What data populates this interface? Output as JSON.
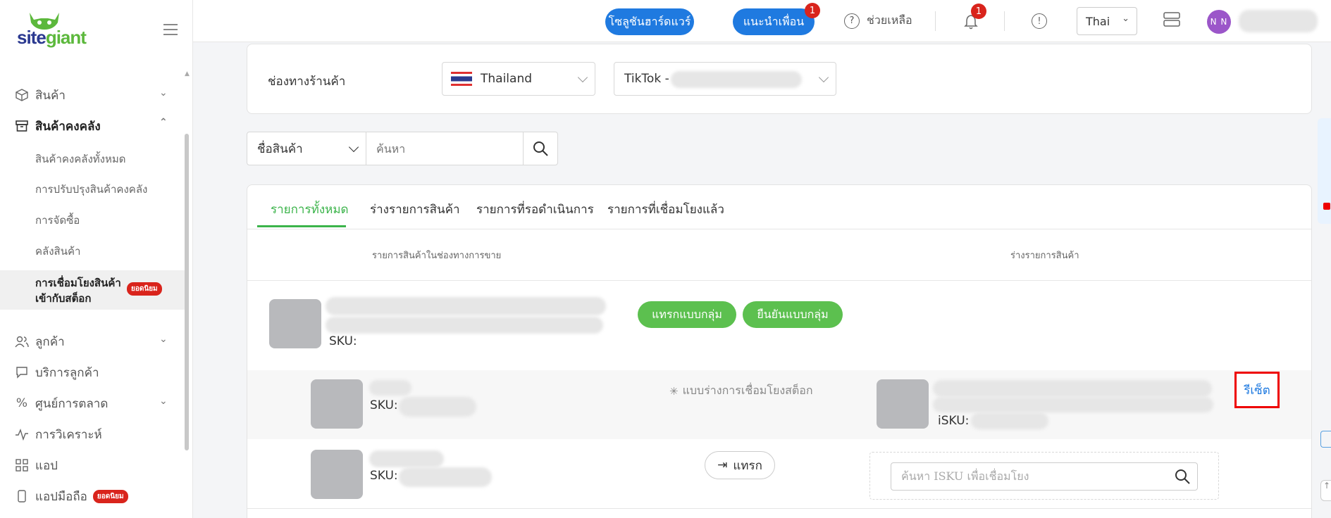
{
  "sidebar": {
    "logo_part1": "site",
    "logo_part2": "giant",
    "items": [
      {
        "label": "สินค้า"
      },
      {
        "label": "สินค้าคงคลัง"
      },
      {
        "label": "ลูกค้า"
      },
      {
        "label": "บริการลูกค้า"
      },
      {
        "label": "ศูนย์การตลาด"
      },
      {
        "label": "การวิเคราะห์"
      },
      {
        "label": "แอป"
      },
      {
        "label": "แอปมือถือ"
      }
    ],
    "sub_items": [
      {
        "label": "สินค้าคงคลังทั้งหมด"
      },
      {
        "label": "การปรับปรุงสินค้าคงคลัง"
      },
      {
        "label": "การจัดซื้อ"
      },
      {
        "label": "คลังสินค้า"
      }
    ],
    "active_sub_line1": "การเชื่อมโยงสินค้า",
    "active_sub_line2": "เข้ากับสต็อก",
    "badge_popular": "ยอดนิยม"
  },
  "topbar": {
    "hardware_btn": "โซลูชันฮาร์ดแวร์",
    "refer_btn": "แนะนำเพื่อน",
    "refer_count": "1",
    "help": "ช่วยเหลือ",
    "bell_count": "1",
    "language": "Thai",
    "avatar_initials": "N N"
  },
  "channel": {
    "label": "ช่องทางร้านค้า",
    "country": "Thailand",
    "store_prefix": "TikTok -"
  },
  "search": {
    "field_select": "ชื่อสินค้า",
    "placeholder": "ค้นหา"
  },
  "tabs": [
    {
      "label": "รายการทั้งหมด"
    },
    {
      "label": "ร่างรายการสินค้า"
    },
    {
      "label": "รายการที่รอดำเนินการ"
    },
    {
      "label": "รายการที่เชื่อมโยงแล้ว"
    }
  ],
  "table": {
    "col_left": "รายการสินค้าในช่องทางการขาย",
    "col_right": "ร่างรายการสินค้า"
  },
  "product": {
    "sku_label": "SKU:",
    "bulk_insert": "แทรกแบบกลุ่ม",
    "bulk_confirm": "ยืนยันแบบกลุ่ม"
  },
  "rows": [
    {
      "sku_label": "SKU:",
      "status": "แบบร่างการเชื่อมโยงสต็อก",
      "isku_label": "iSKU:",
      "reset": "รีเซ็ต"
    },
    {
      "sku_label": "SKU:",
      "insert": "แทรก",
      "isku_placeholder": "ค้นหา ISKU เพื่อเชื่อมโยง"
    }
  ],
  "colors": {
    "primary_blue": "#1f7ae0",
    "green": "#5cc04f",
    "tab_green": "#3cb44b",
    "badge_red": "#d9241c",
    "highlight_red": "#ee0000"
  }
}
